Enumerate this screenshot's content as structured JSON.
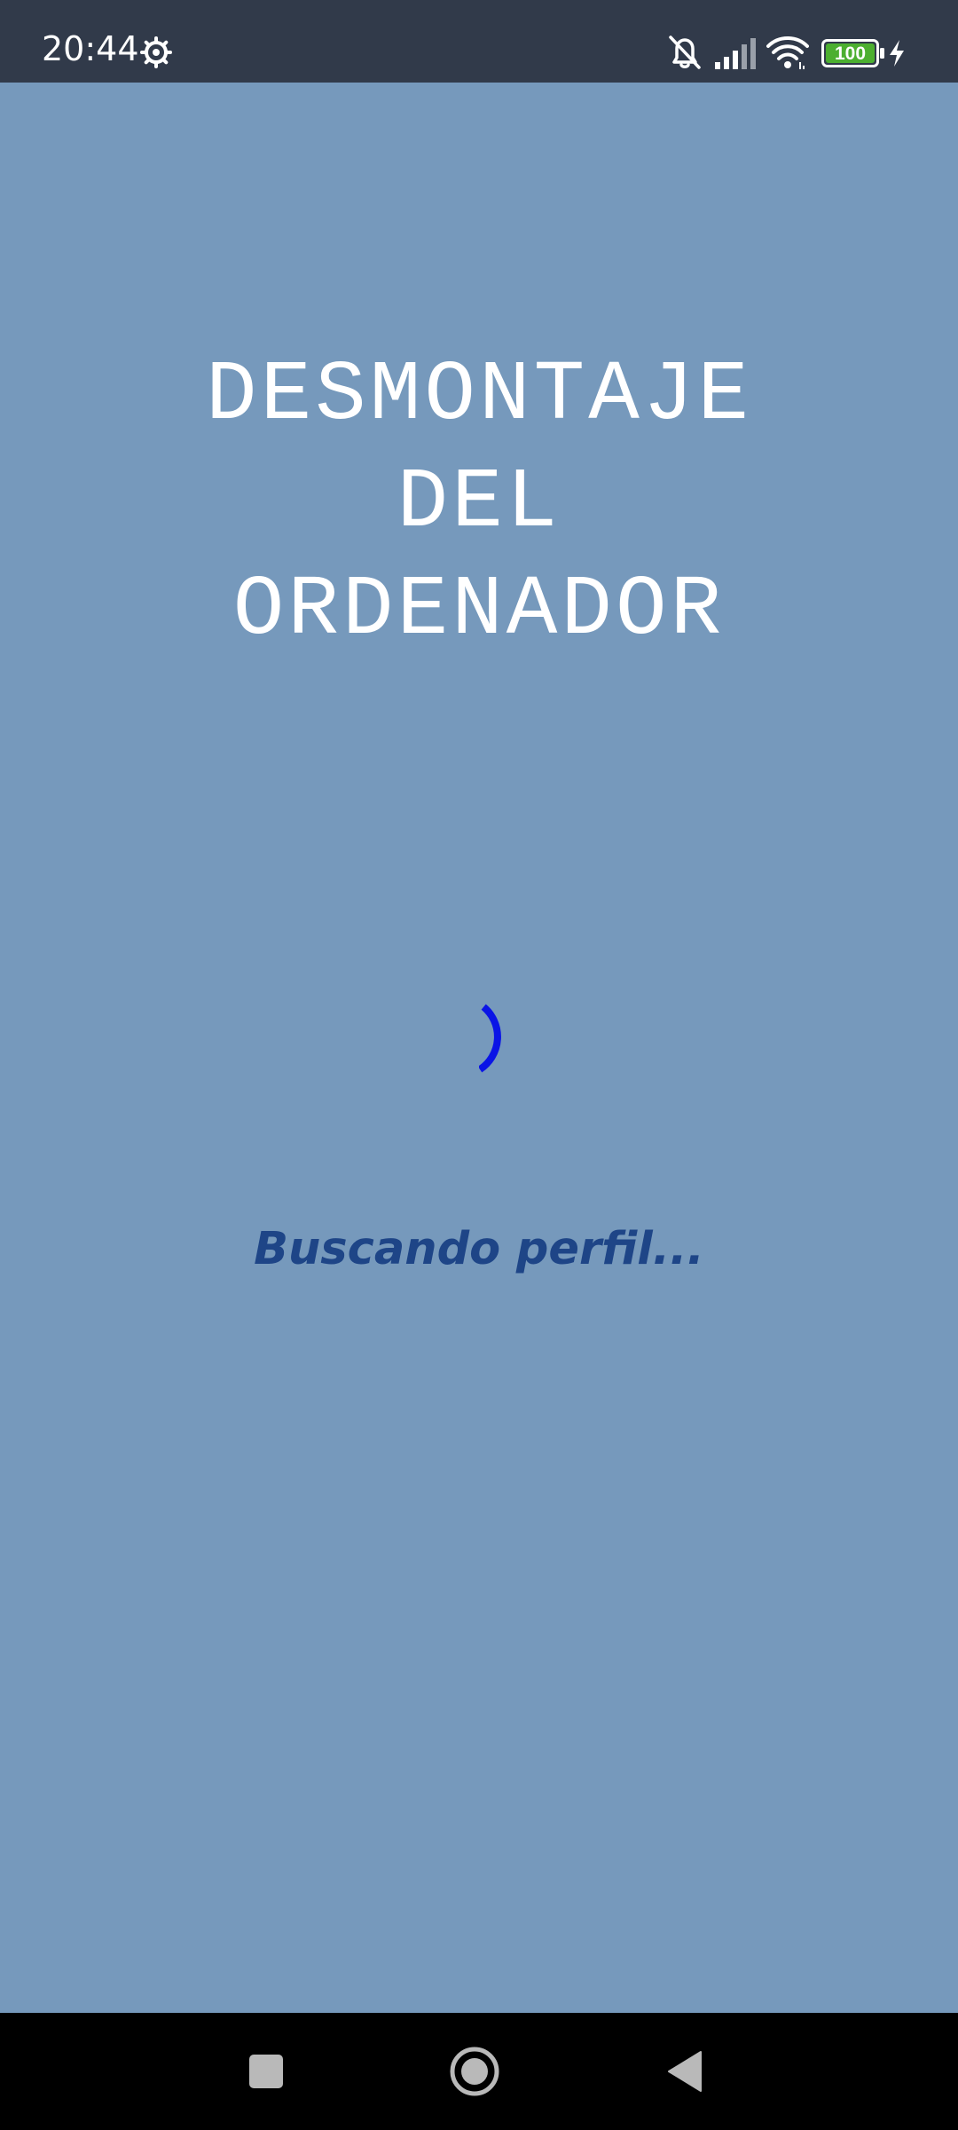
{
  "status_bar": {
    "time": "20:44",
    "battery_level": "100",
    "icons": [
      "gear-icon",
      "bell-off-icon",
      "signal-icon",
      "wifi-icon",
      "battery-icon",
      "charging-icon"
    ],
    "background_color": "#313a4a",
    "battery_color": "#4caf30"
  },
  "main": {
    "title_lines": [
      "DESMONTAJE",
      "DEL",
      "ORDENADOR"
    ],
    "loading_text": "Buscando perfil...",
    "background_color": "#7699bc",
    "spinner_color": "#0a14e6",
    "loading_text_color": "#1e4587"
  },
  "nav_bar": {
    "buttons": [
      "recents-button",
      "home-button",
      "back-button"
    ]
  }
}
